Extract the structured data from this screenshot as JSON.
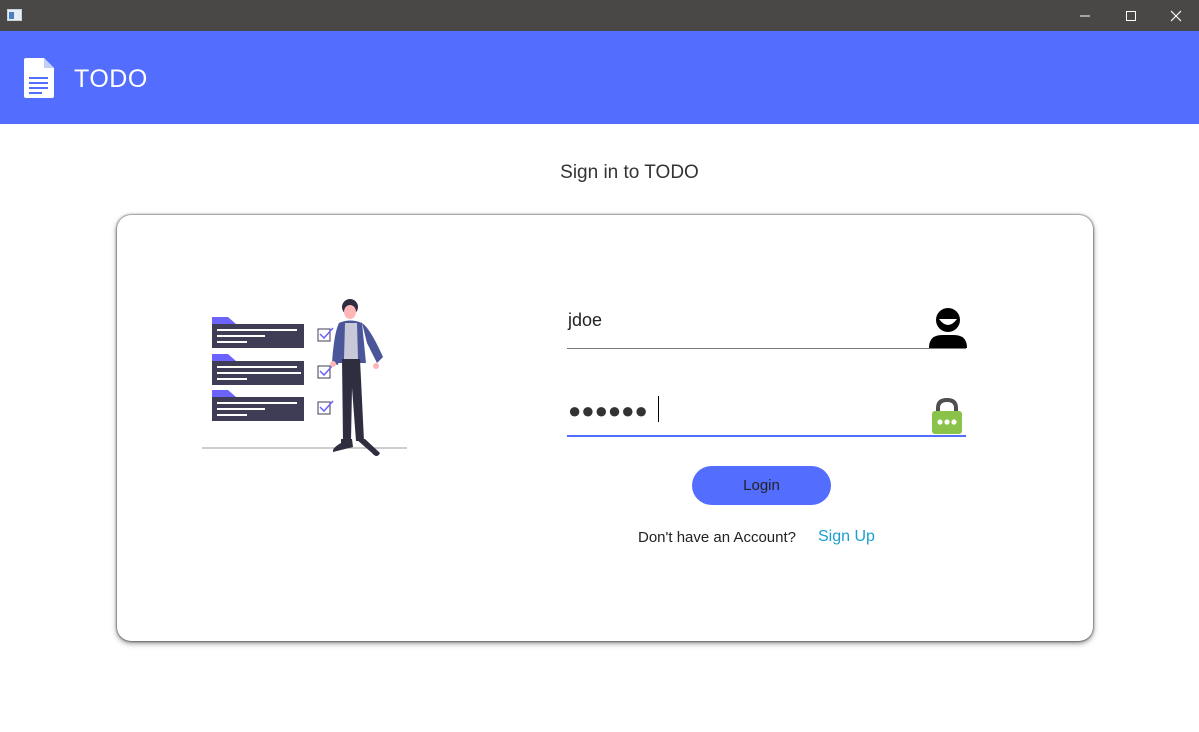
{
  "window": {
    "app_icon": "window-app-icon",
    "controls": [
      "minimize-icon",
      "maximize-icon",
      "close-icon"
    ]
  },
  "header": {
    "logo_icon": "document-icon",
    "app_name": "TODO"
  },
  "main": {
    "title": "Sign in to TODO",
    "illustration": "person-checklist-illustration",
    "username": {
      "value": "jdoe",
      "icon": "user-icon"
    },
    "password": {
      "masked_value": "●●●●●●",
      "icon": "lock-icon"
    },
    "login_label": "Login",
    "signup_prompt": "Don't have an Account?",
    "signup_link": "Sign Up"
  },
  "colors": {
    "accent": "#536dfe",
    "titlebar": "#494846",
    "link": "#1a9fd0",
    "lock": "#8bc34a"
  }
}
